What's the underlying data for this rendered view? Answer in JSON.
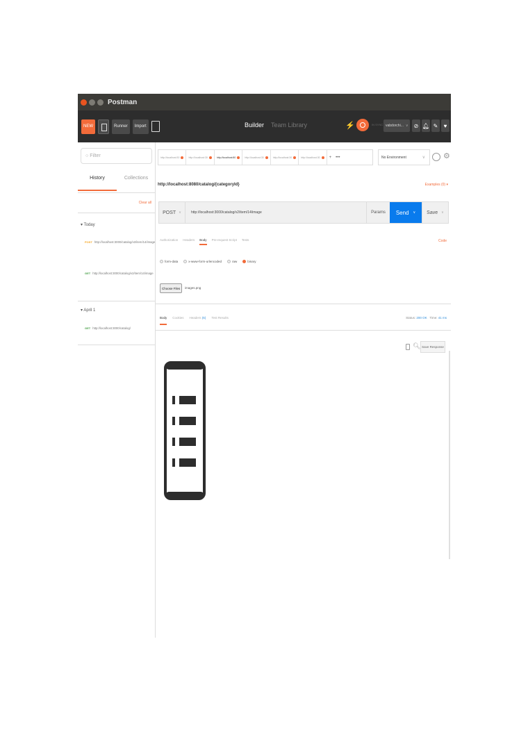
{
  "app": {
    "title": "Postman"
  },
  "toolbar": {
    "new_label": "NEW",
    "runner_label": "Runner",
    "import_label": "Import",
    "builder_tab": "Builder",
    "team_tab": "Team Library",
    "sync_status": "IN SYNC",
    "user": "vabdorchi...",
    "brand_color": "#f26b3a"
  },
  "sidebar": {
    "filter_placeholder": "Filter",
    "tabs": [
      "History",
      "Collections"
    ],
    "clear_all": "Clear all",
    "groups": [
      {
        "label": "Today",
        "items": [
          {
            "method": "POST",
            "url": "http://localhost:3000/catalog/v2/item/14/image"
          },
          {
            "method": "GET",
            "url": "http://localhost:3000/catalog/v2/item/14/image"
          }
        ]
      },
      {
        "label": "April 1",
        "items": [
          {
            "method": "GET",
            "url": "http://localhost:3000/catalog/"
          }
        ]
      }
    ]
  },
  "tabs": [
    "http://localhost:30",
    "http://localhost:30",
    "http://localhost:80",
    "http://localhost:30",
    "http://localhost:30",
    "http://localhost:30"
  ],
  "tab_plus": "+",
  "tab_more": "•••",
  "environment": "No Environment",
  "request": {
    "title": "http://localhost:8080/catalog/{categoryId}",
    "examples": "Examples (0) ▾",
    "method": "POST",
    "url": "http://localhost:3000/catalog/v2/item/14/image",
    "params_label": "Params",
    "send_label": "Send",
    "save_label": "Save",
    "tabs": [
      "Authorization",
      "Headers",
      "Body",
      "Pre-request Script",
      "Tests"
    ],
    "active_tab": "Body",
    "code_label": "Code",
    "body_modes": [
      "form-data",
      "x-www-form-urlencoded",
      "raw",
      "binary"
    ],
    "selected_mode": "binary",
    "choose_files": "Choose Files",
    "file_name": "images.png"
  },
  "response": {
    "tabs": [
      "Body",
      "Cookies",
      "Headers",
      "Test Results"
    ],
    "headers_count": "(6)",
    "status_label": "Status:",
    "status_value": "200 OK",
    "time_label": "Time:",
    "time_value": "41 ms",
    "save_response": "Save Response"
  }
}
